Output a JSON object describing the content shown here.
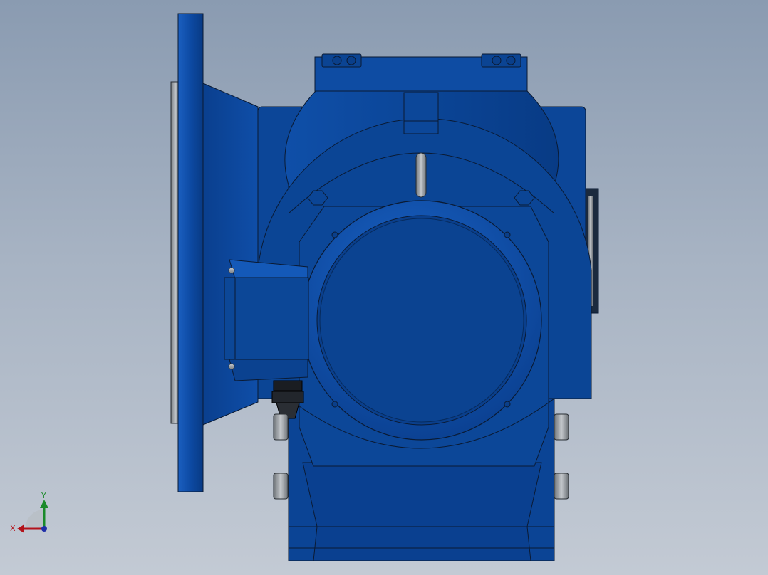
{
  "viewport": {
    "model": "gear-reducer-motor-assembly",
    "background_top": "#8a9bb1",
    "background_bottom": "#c3cad4"
  },
  "colors": {
    "body_blue": "#0d4c9f",
    "dark_blue": "#083a7e",
    "edge": "#0a1a33",
    "steel": "#9ea3a8"
  },
  "triad": {
    "x_label": "X",
    "y_label": "Y",
    "x_color": "#b3121a",
    "y_color": "#1a8a2a",
    "z_color": "#1f2ea8"
  }
}
